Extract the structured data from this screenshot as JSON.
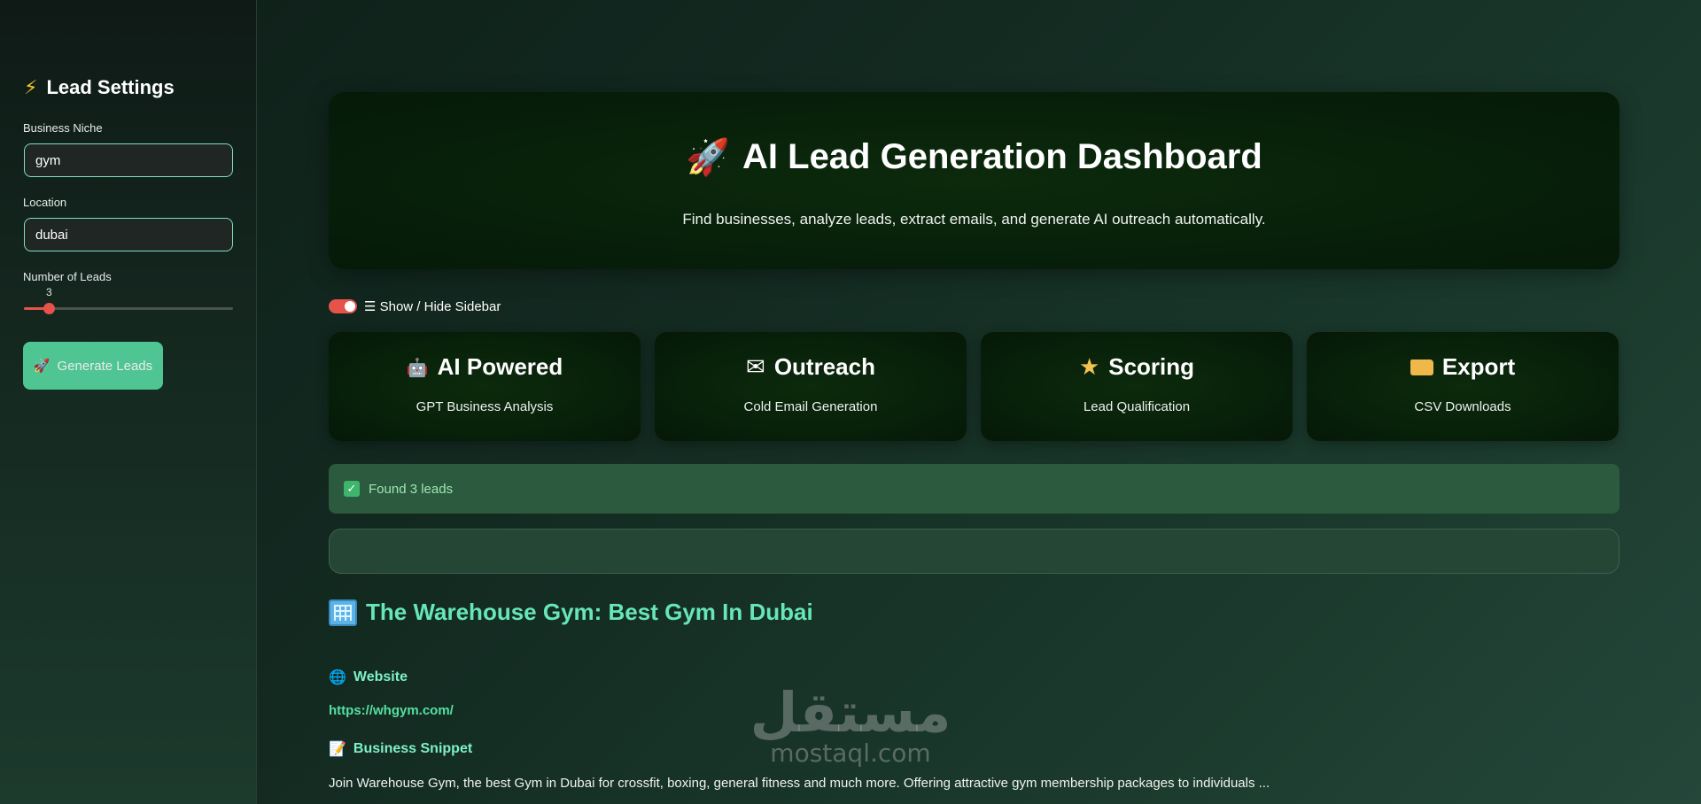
{
  "sidebar": {
    "title": "Lead Settings",
    "niche_label": "Business Niche",
    "niche_value": "gym",
    "location_label": "Location",
    "location_value": "dubai",
    "leads_label": "Number of Leads",
    "leads_value": "3",
    "leads_slider_fraction": 0.12,
    "generate_label": "Generate Leads"
  },
  "hero": {
    "title": "AI Lead Generation Dashboard",
    "subtitle": "Find businesses, analyze leads, extract emails, and generate AI outreach automatically."
  },
  "toggle": {
    "label": "☰ Show / Hide Sidebar",
    "on": true
  },
  "features": [
    {
      "title": "AI Powered",
      "subtitle": "GPT Business Analysis",
      "icon": "robot-icon"
    },
    {
      "title": "Outreach",
      "subtitle": "Cold Email Generation",
      "icon": "envelope-icon"
    },
    {
      "title": "Scoring",
      "subtitle": "Lead Qualification",
      "icon": "star-icon"
    },
    {
      "title": "Export",
      "subtitle": "CSV Downloads",
      "icon": "folder-icon"
    }
  ],
  "status": {
    "message": "Found 3 leads"
  },
  "lead": {
    "title": "The Warehouse Gym: Best Gym In Dubai",
    "website_heading": "Website",
    "website_url": "https://whgym.com/",
    "snippet_heading": "Business Snippet",
    "snippet": "Join Warehouse Gym, the best Gym in Dubai for crossfit, boxing, general fitness and much more. Offering attractive gym membership packages to individuals ..."
  },
  "watermark": {
    "arabic": "مستقل",
    "latin": "mostaql.com"
  },
  "colors": {
    "accent": "#e5534b",
    "primary_button": "#56d6a1",
    "lead_title": "#67e6b8"
  }
}
